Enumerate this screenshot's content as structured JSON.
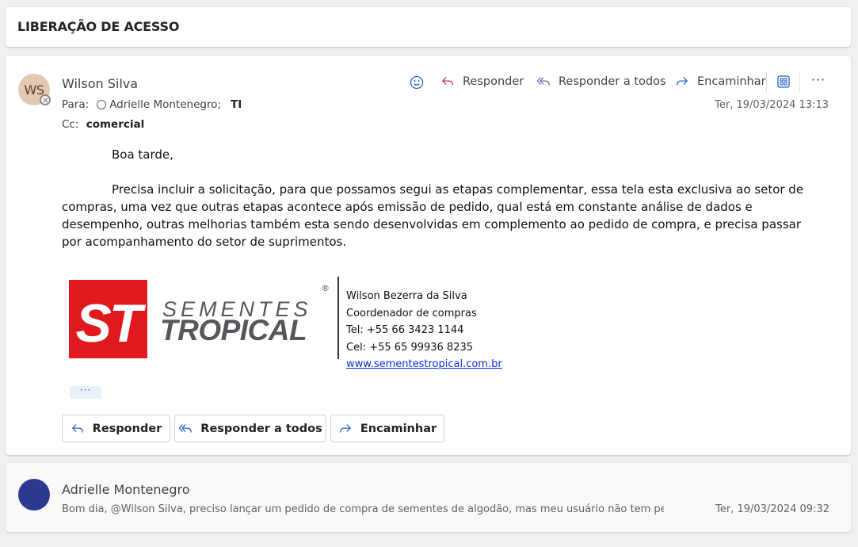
{
  "subject": "LIBERAÇÃO DE ACESSO",
  "message": {
    "avatar_initials": "WS",
    "sender": "Wilson Silva",
    "to_label": "Para:",
    "to_recipient": "Adrielle Montenegro;",
    "to_group": "TI",
    "cc_label": "Cc:",
    "cc_group": "comercial",
    "date": "Ter, 19/03/2024 13:13",
    "actions": {
      "reply": "Responder",
      "reply_all": "Responder a todos",
      "forward": "Encaminhar",
      "more": "···"
    },
    "greeting": "Boa tarde,",
    "paragraph": "Precisa incluir a solicitação, para que possamos segui as etapas complementar, essa tela esta exclusiva ao setor de compras, uma vez que outras etapas acontece após emissão de pedido, qual está em constante análise de dados e desempenho, outras melhorias também esta sendo desenvolvidas em complemento ao pedido de compra, e precisa passar por acompanhamento do setor de suprimentos.",
    "signature": {
      "logo_mark": "ST",
      "logo_word1": "SEMENTES",
      "logo_word2": "TROPICAL",
      "logo_reg": "®",
      "name": "Wilson Bezerra da Silva",
      "role": "Coordenador de compras",
      "tel": "Tel: +55 66 3423 1144",
      "cel": "Cel: +55 65 99936 8235",
      "website": "www.sementestropical.com.br"
    },
    "expand_label": "···",
    "buttons": {
      "reply": "Responder",
      "reply_all": "Responder a todos",
      "forward": "Encaminhar"
    }
  },
  "previous_message": {
    "sender": "Adrielle Montenegro",
    "preview": "Bom dia, @Wilson Silva, preciso lançar um pedido de compra de sementes de algodão, mas meu usuário não tem permissã...",
    "date": "Ter, 19/03/2024 09:32"
  },
  "colors": {
    "logo_red": "#e0191f",
    "logo_gray": "#55575a",
    "link_blue": "#0b2fd6",
    "avatar_bg": "#e2c9b2",
    "avatar2_bg": "#2b3990"
  }
}
